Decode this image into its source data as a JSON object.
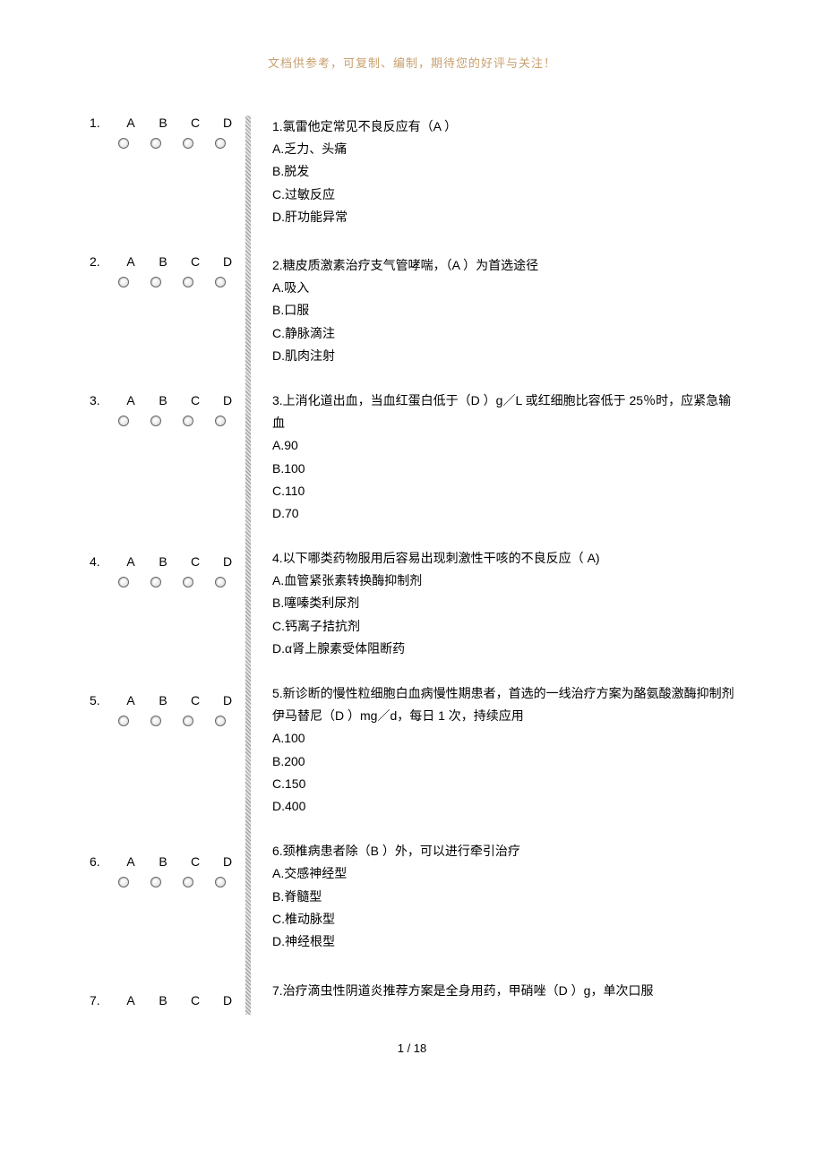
{
  "header_note": "文档供参考，可复制、编制，期待您的好评与关注！",
  "option_letters": [
    "A",
    "B",
    "C",
    "D"
  ],
  "questions": [
    {
      "num": "1.",
      "text": "1.氯雷他定常见不良反应有（A ）",
      "options": [
        "A.乏力、头痛",
        "B.脱发",
        "C.过敏反应",
        "D.肝功能异常"
      ]
    },
    {
      "num": "2.",
      "text": "2.糖皮质激素治疗支气管哮喘，（A ）为首选途径",
      "options": [
        "A.吸入",
        "B.口服",
        "C.静脉滴注",
        "D.肌肉注射"
      ]
    },
    {
      "num": "3.",
      "text": "3.上消化道出血，当血红蛋白低于（D ）g／L 或红细胞比容低于 25％时，应紧急输血",
      "options": [
        "A.90",
        "B.100",
        "C.110",
        "D.70"
      ]
    },
    {
      "num": "4.",
      "text": "4.以下哪类药物服用后容易出现刺激性干咳的不良反应（ A)",
      "options": [
        "A.血管紧张素转换酶抑制剂",
        "B.噻嗪类利尿剂",
        "C.钙离子拮抗剂",
        "D.α肾上腺素受体阻断药"
      ]
    },
    {
      "num": "5.",
      "text": "5.新诊断的慢性粒细胞白血病慢性期患者，首选的一线治疗方案为酪氨酸激酶抑制剂伊马替尼（D ）mg／d，每日 1 次，持续应用",
      "options": [
        "A.100",
        "B.200",
        "C.150",
        "D.400"
      ]
    },
    {
      "num": "6.",
      "text": "6.颈椎病患者除（B ）外，可以进行牵引治疗",
      "options": [
        "A.交感神经型",
        "B.脊髓型",
        "C.椎动脉型",
        "D.神经根型"
      ]
    },
    {
      "num": "7.",
      "text": "7.治疗滴虫性阴道炎推荐方案是全身用药，甲硝唑（D ）g，单次口服",
      "options": []
    }
  ],
  "page_footer": "1   /  18"
}
